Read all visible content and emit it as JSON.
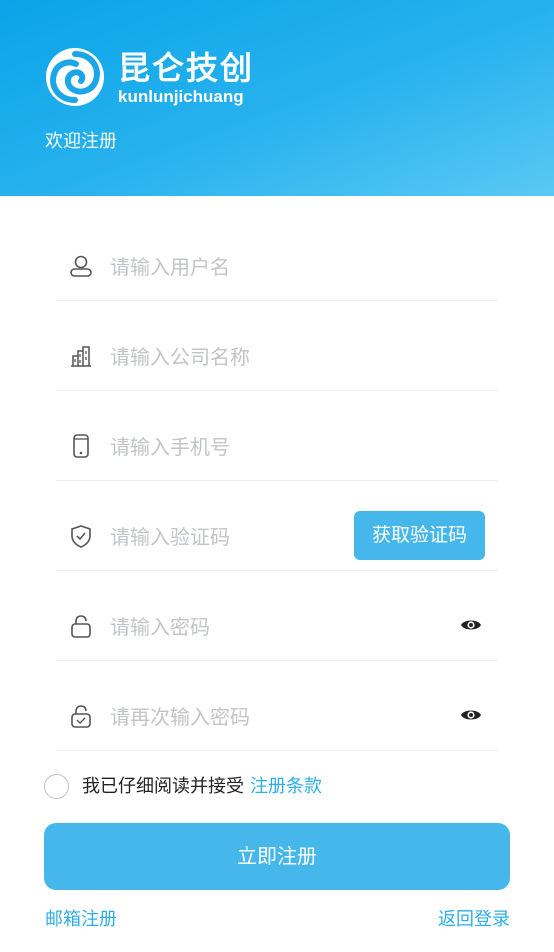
{
  "header": {
    "brand_cn": "昆仑技创",
    "brand_en": "kunlunjichuang",
    "welcome": "欢迎注册",
    "brand_color": "#0aa4e8"
  },
  "form": {
    "username": {
      "placeholder": "请输入用户名",
      "icon": "user-icon"
    },
    "company": {
      "placeholder": "请输入公司名称",
      "icon": "building-icon"
    },
    "phone": {
      "placeholder": "请输入手机号",
      "icon": "phone-icon"
    },
    "code": {
      "placeholder": "请输入验证码",
      "icon": "shield-icon",
      "button_label": "获取验证码"
    },
    "password": {
      "placeholder": "请输入密码",
      "icon": "lock-icon",
      "toggle_icon": "eye-icon"
    },
    "password_confirm": {
      "placeholder": "请再次输入密码",
      "icon": "lock-check-icon",
      "toggle_icon": "eye-icon"
    }
  },
  "agreement": {
    "text": "我已仔细阅读并接受",
    "link": "注册条款",
    "checked": false
  },
  "submit_label": "立即注册",
  "footer": {
    "left_link": "邮箱注册",
    "right_link": "返回登录"
  },
  "accent_color": "#45b7ea"
}
